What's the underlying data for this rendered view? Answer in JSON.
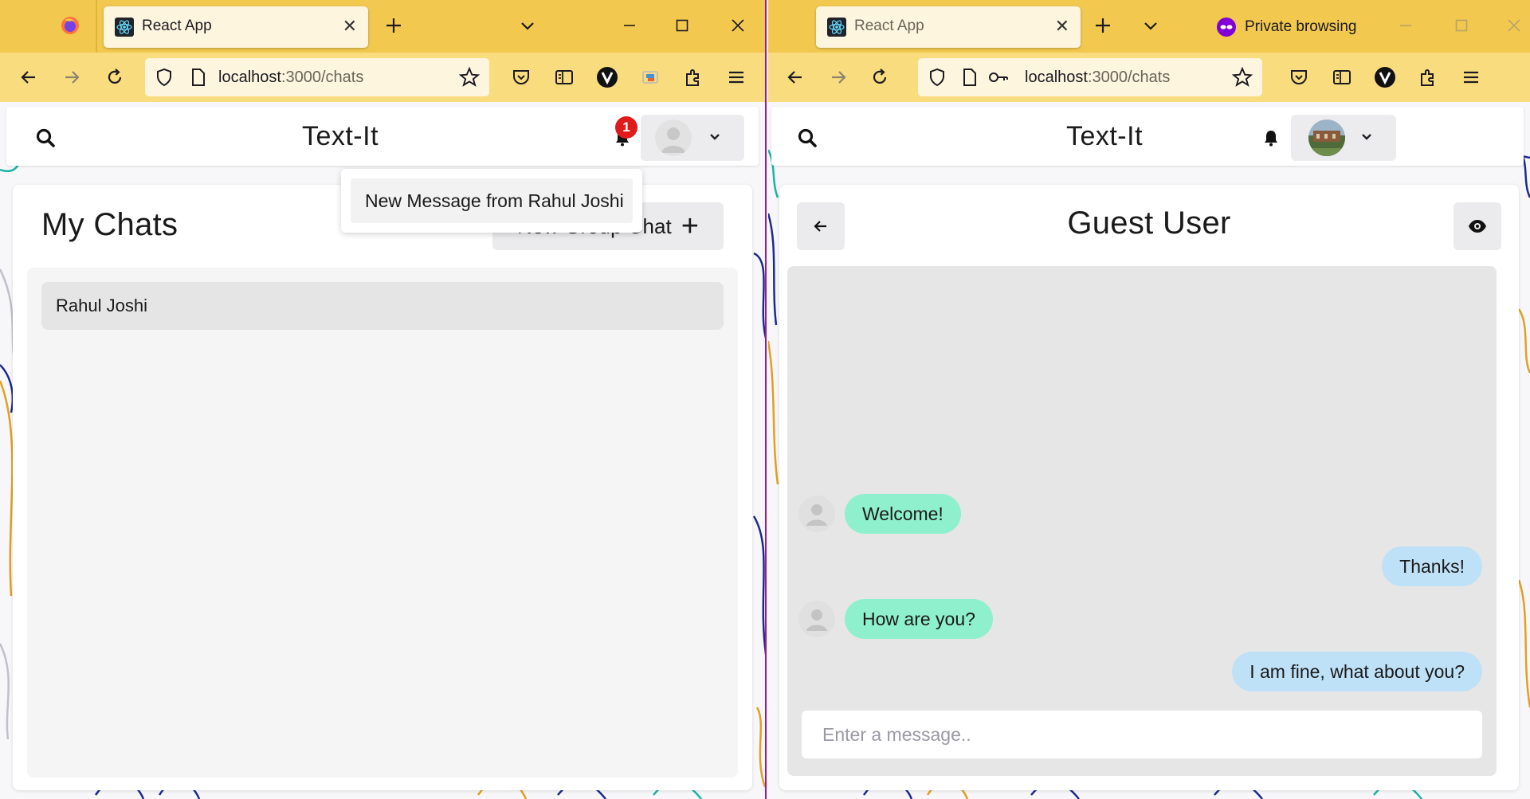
{
  "left": {
    "tab": {
      "title": "React App",
      "close": "✕"
    },
    "url": {
      "host": "localhost",
      "path": ":3000/chats"
    },
    "app": {
      "title": "Text-It",
      "notification_count": "1",
      "notification_message": "New Message from Rahul Joshi",
      "heading": "My Chats",
      "new_group_label": "New Group Chat",
      "plus": "+",
      "chats": [
        {
          "name": "Rahul Joshi"
        }
      ]
    }
  },
  "right": {
    "tab": {
      "title": "React App",
      "close": "✕"
    },
    "private_label": "Private browsing",
    "url": {
      "host": "localhost",
      "path": ":3000/chats"
    },
    "app": {
      "title": "Text-It",
      "chat_title": "Guest User",
      "messages": [
        {
          "text": "Welcome!",
          "direction": "in"
        },
        {
          "text": "Thanks!",
          "direction": "out"
        },
        {
          "text": "How are you?",
          "direction": "in"
        },
        {
          "text": "I am fine, what about you?",
          "direction": "out"
        }
      ],
      "input_placeholder": "Enter a message.."
    }
  },
  "colors": {
    "tabbar": "#f2c84f",
    "toolbar": "#f9dc7d",
    "incoming_bubble": "#8ef0cd",
    "outgoing_bubble": "#bfe1f7",
    "badge": "#e01b1b",
    "private_separator": "#9b1d8f"
  },
  "icons": [
    "firefox-icon",
    "react-favicon",
    "new-tab-icon",
    "list-all-tabs-icon",
    "minimize-icon",
    "maximize-icon",
    "close-window-icon",
    "back-icon",
    "forward-icon",
    "reload-icon",
    "shield-icon",
    "page-icon",
    "key-icon",
    "bookmark-star-icon",
    "pocket-icon",
    "reader-view-icon",
    "v-extension-icon",
    "screenshot-icon",
    "extensions-icon",
    "menu-icon",
    "search-icon",
    "bell-icon",
    "chevron-down-icon",
    "eye-icon",
    "arrow-left-icon",
    "private-mask-icon"
  ]
}
